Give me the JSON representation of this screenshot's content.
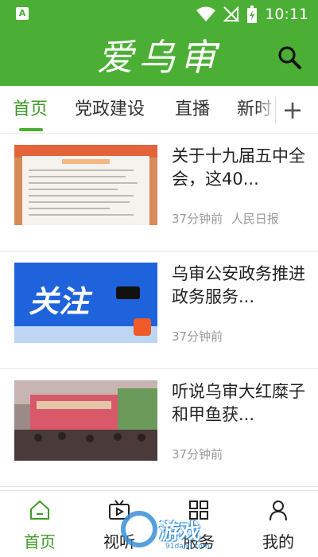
{
  "status_bar": {
    "time": "10:11",
    "left_icon": "A"
  },
  "header": {
    "app_title": "爱乌审",
    "search_icon": "search-icon"
  },
  "tabs": [
    {
      "label": "首页",
      "active": true
    },
    {
      "label": "党政建设",
      "active": false
    },
    {
      "label": "直播",
      "active": false
    },
    {
      "label": "新时",
      "active": false
    }
  ],
  "tabs_more_label": "+",
  "articles": [
    {
      "title": "关于十九届五中全会，这40...",
      "time": "37分钟前",
      "source": "人民日报"
    },
    {
      "title": "乌审公安政务推进政务服务...",
      "time": "37分钟前",
      "source": "",
      "image_text": "关注"
    },
    {
      "title": "听说乌审大红糜子和甲鱼获...",
      "time": "37分钟前",
      "source": ""
    }
  ],
  "bottom_nav": [
    {
      "label": "首页",
      "icon": "home-icon",
      "active": true
    },
    {
      "label": "视听",
      "icon": "video-icon",
      "active": false
    },
    {
      "label": "服务",
      "icon": "grid-icon",
      "active": false
    },
    {
      "label": "我的",
      "icon": "user-icon",
      "active": false
    }
  ],
  "watermark": {
    "text": "游戏",
    "sub": "91danji.com"
  },
  "colors": {
    "brand_green": "#4caf35",
    "active_text": "#3f9a2a"
  }
}
